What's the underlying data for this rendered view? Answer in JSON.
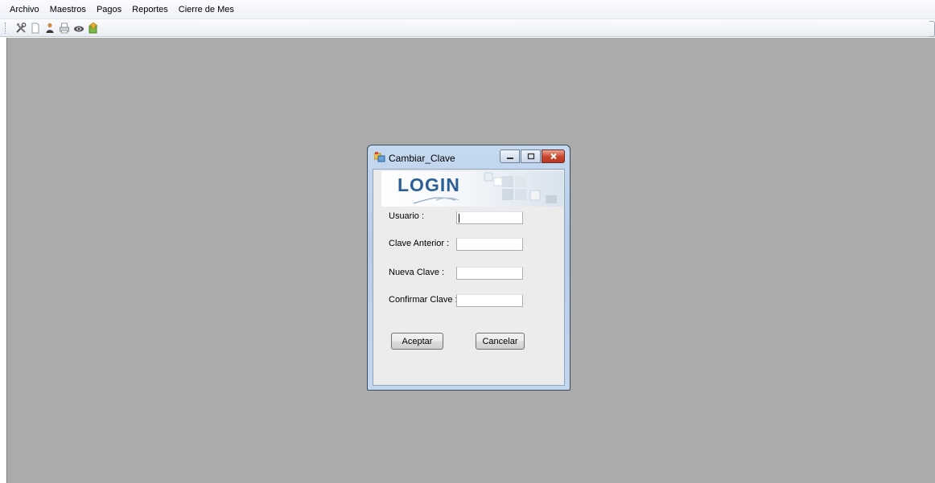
{
  "menubar": {
    "items": [
      "Archivo",
      "Maestros",
      "Pagos",
      "Reportes",
      "Cierre de Mes"
    ]
  },
  "toolbar": {
    "buttons": [
      "tools-icon",
      "document-icon",
      "person-icon",
      "printer-icon",
      "eye-icon",
      "exit-icon"
    ]
  },
  "dialog": {
    "title": "Cambiar_Clave",
    "banner_text": "LOGIN",
    "fields": [
      {
        "label": "Usuario :",
        "value": ""
      },
      {
        "label": "Clave Anterior :",
        "value": ""
      },
      {
        "label": "Nueva Clave :",
        "value": ""
      },
      {
        "label": "Confirmar Clave :",
        "value": ""
      }
    ],
    "accept_label": "Aceptar",
    "cancel_label": "Cancelar"
  },
  "colors": {
    "mdi_background": "#ababab",
    "logo_blue": "#2d5f96",
    "close_button": "#c9452d"
  }
}
